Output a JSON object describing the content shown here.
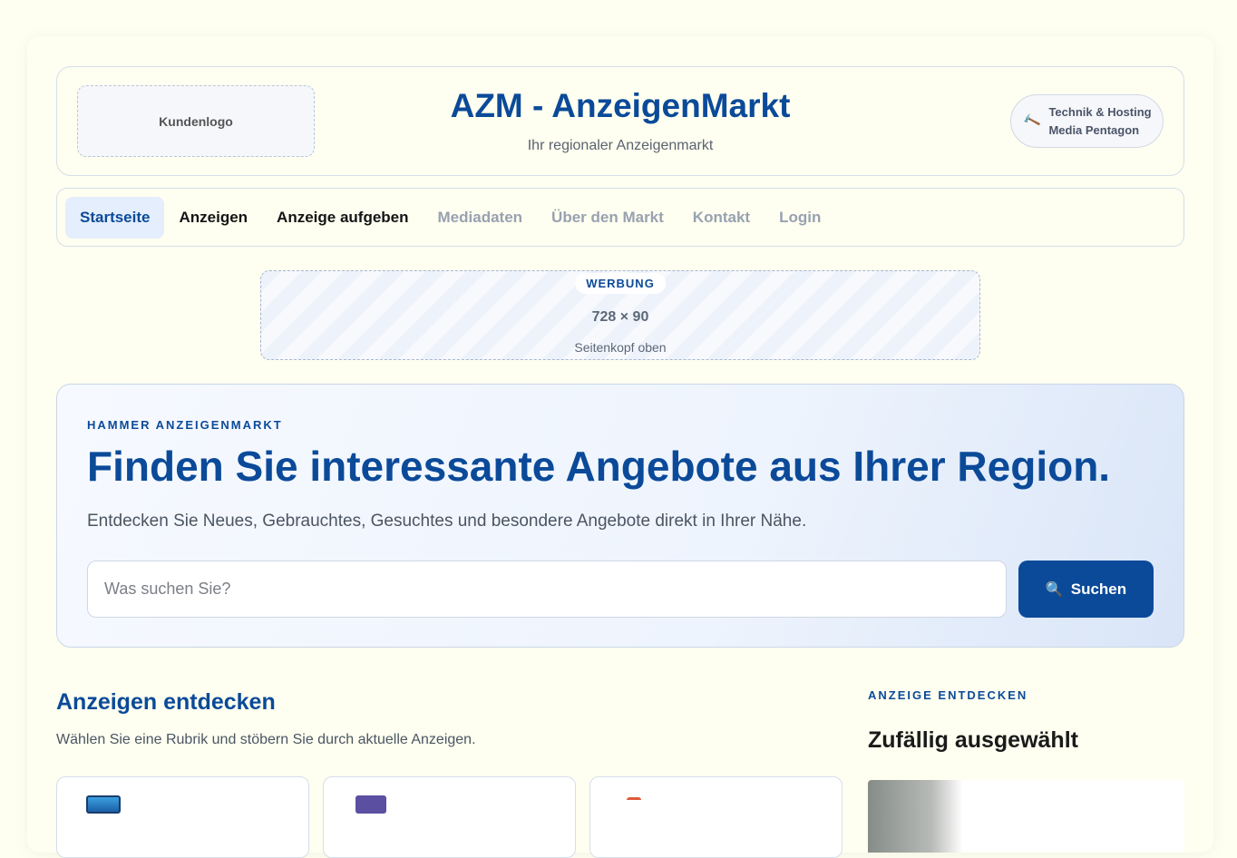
{
  "header": {
    "logo_placeholder": "Kundenlogo",
    "title": "AZM - AnzeigenMarkt",
    "subtitle": "Ihr regionaler Anzeigenmarkt",
    "tech_line1": "Technik & Hosting",
    "tech_line2": "Media Pentagon",
    "tech_icon": "hammer-icon"
  },
  "nav": {
    "items": [
      {
        "label": "Startseite",
        "state": "active"
      },
      {
        "label": "Anzeigen",
        "state": "normal"
      },
      {
        "label": "Anzeige aufgeben",
        "state": "normal"
      },
      {
        "label": "Mediadaten",
        "state": "muted"
      },
      {
        "label": "Über den Markt",
        "state": "muted"
      },
      {
        "label": "Kontakt",
        "state": "muted"
      },
      {
        "label": "Login",
        "state": "muted"
      }
    ]
  },
  "ad": {
    "tag": "WERBUNG",
    "size": "728 × 90",
    "position": "Seitenkopf oben"
  },
  "hero": {
    "eyebrow": "HAMMER ANZEIGENMARKT",
    "title": "Finden Sie interessante Angebote aus Ihrer Region.",
    "text": "Entdecken Sie Neues, Gebrauchtes, Gesuchtes und besondere Angebote direkt in Ihrer Nähe.",
    "search_placeholder": "Was suchen Sie?",
    "search_value": "",
    "search_button": "Suchen",
    "search_icon": "magnifier-icon"
  },
  "discover": {
    "title": "Anzeigen entdecken",
    "text": "Wählen Sie eine Rubrik und stöbern Sie durch aktuelle Anzeigen."
  },
  "sidebar": {
    "eyebrow": "ANZEIGE ENTDECKEN",
    "title": "Zufällig ausgewählt"
  },
  "colors": {
    "brand": "#0b4a99",
    "background": "#fefff0",
    "nav_active_bg": "#e4eefc",
    "muted": "#98a1b0"
  }
}
